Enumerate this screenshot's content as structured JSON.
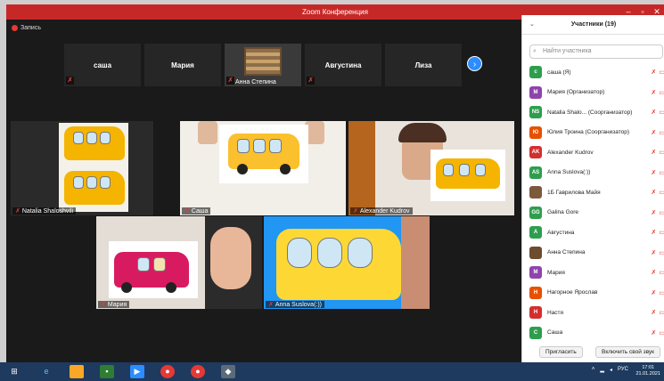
{
  "window": {
    "title": "Zoom Конференция"
  },
  "recording": {
    "label": "Запись"
  },
  "strip": [
    {
      "name": "саша",
      "caption": ""
    },
    {
      "name": "Мария",
      "caption": ""
    },
    {
      "name": "",
      "caption": "Анна Степина"
    },
    {
      "name": "Августина",
      "caption": ""
    },
    {
      "name": "Лиза",
      "caption": ""
    }
  ],
  "videos": [
    {
      "name": "Natalia Shaloshvili"
    },
    {
      "name": "Саша"
    },
    {
      "name": "Alexander Kudrov"
    },
    {
      "name": "Мария"
    },
    {
      "name": "Anna Suslova(:))"
    }
  ],
  "panel": {
    "title": "Участники (19)",
    "search_placeholder": "Найти участника",
    "participants": [
      {
        "initials": "с",
        "color": "#2e9e4e",
        "name": "саша (Я)"
      },
      {
        "initials": "М",
        "color": "#8e44ad",
        "name": "Мария (Организатор)"
      },
      {
        "initials": "NS",
        "color": "#2e9e4e",
        "name": "Natalia Shalo... (Соорганизатор)"
      },
      {
        "initials": "Ю",
        "color": "#e65100",
        "name": "Юлия Троина (Соорганизатор)"
      },
      {
        "initials": "AK",
        "color": "#d32f2f",
        "name": "Alexander Kudrov"
      },
      {
        "initials": "AS",
        "color": "#2e9e4e",
        "name": "Anna Suslova(:))"
      },
      {
        "initials": "",
        "color": "#7b5a3c",
        "name": "1Б Гаврилова Майя"
      },
      {
        "initials": "GG",
        "color": "#2e9e4e",
        "name": "Galina Gore"
      },
      {
        "initials": "А",
        "color": "#2e9e4e",
        "name": "Августина"
      },
      {
        "initials": "",
        "color": "#6d4c2f",
        "name": "Анна Степина"
      },
      {
        "initials": "М",
        "color": "#8e44ad",
        "name": "Мария"
      },
      {
        "initials": "Н",
        "color": "#e65100",
        "name": "Нагорное Ярослав"
      },
      {
        "initials": "Н",
        "color": "#d32f2f",
        "name": "Настя"
      },
      {
        "initials": "С",
        "color": "#2e9e4e",
        "name": "Саша"
      }
    ],
    "invite_label": "Пригласить",
    "unmute_label": "Включить свой звук"
  },
  "taskbar": {
    "lang": "РУС",
    "time": "17:01",
    "date": "21.01.2021"
  }
}
